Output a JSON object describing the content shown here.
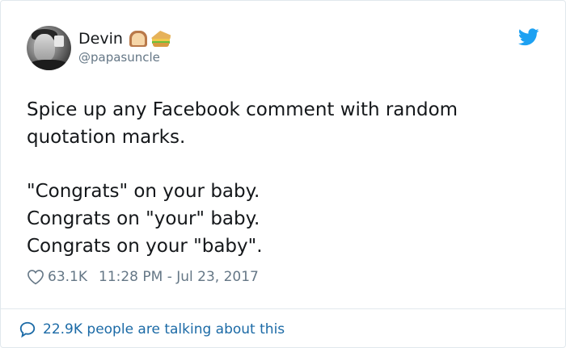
{
  "user": {
    "display_name": "Devin",
    "handle": "@papasuncle",
    "name_emoji": [
      "bread-icon",
      "sandwich-icon"
    ]
  },
  "tweet": {
    "intro_lines": [
      "Spice up any Facebook comment with random",
      "quotation marks."
    ],
    "example_lines": [
      "\"Congrats\" on your baby.",
      "Congrats on \"your\" baby.",
      "Congrats on your \"baby\"."
    ]
  },
  "meta": {
    "like_count": "63.1K",
    "timestamp": "11:28 PM - Jul 23, 2017"
  },
  "footer": {
    "talking_text": "22.9K people are talking about this"
  },
  "colors": {
    "twitter_blue": "#1da1f2",
    "link_blue": "#1b6aa6",
    "muted": "#657786",
    "text": "#14171a",
    "border": "#e1e8ed"
  }
}
